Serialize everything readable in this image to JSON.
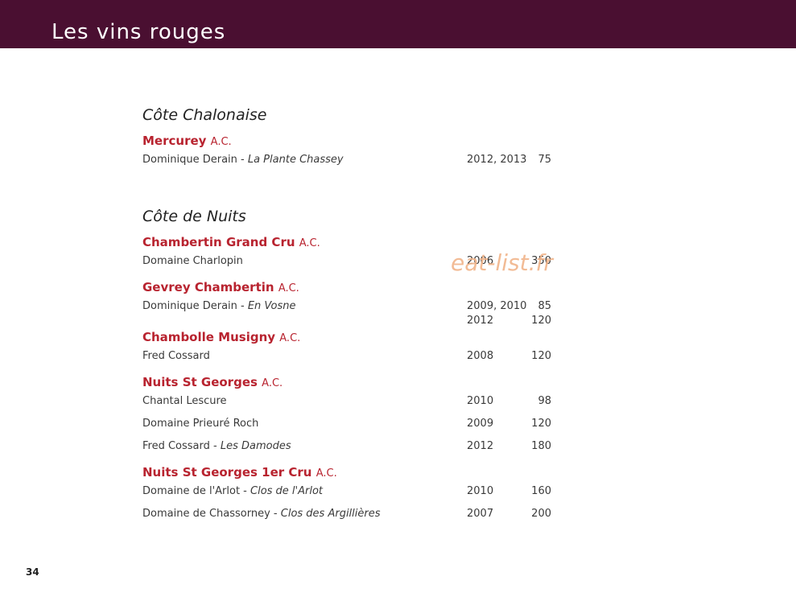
{
  "header": {
    "title": "Les vins rouges"
  },
  "sections": [
    {
      "title": "Côte Chalonaise",
      "appellations": [
        {
          "name": "Mercurey",
          "ac": "A.C.",
          "wines": [
            {
              "producer": "Dominique Derain - ",
              "cuvee": "La Plante Chassey",
              "vintage": "2012, 2013",
              "price": "75"
            }
          ]
        }
      ]
    },
    {
      "title": "Côte de Nuits",
      "appellations": [
        {
          "name": "Chambertin Grand Cru",
          "ac": "A.C.",
          "wines": [
            {
              "producer": "Domaine Charlopin",
              "cuvee": "",
              "vintage": "2006",
              "price": "350"
            }
          ]
        },
        {
          "name": "Gevrey Chambertin",
          "ac": "A.C.",
          "wines": [
            {
              "producer": "Dominique Derain - ",
              "cuvee": "En Vosne",
              "vintage": "2009, 2010",
              "price": "85"
            },
            {
              "producer": "",
              "cuvee": "",
              "vintage": "2012",
              "price": "120"
            }
          ]
        },
        {
          "name": "Chambolle Musigny",
          "ac": "A.C.",
          "wines": [
            {
              "producer": "Fred Cossard",
              "cuvee": "",
              "vintage": "2008",
              "price": "120"
            }
          ]
        },
        {
          "name": "Nuits St Georges",
          "ac": "A.C.",
          "wines": [
            {
              "producer": "Chantal Lescure",
              "cuvee": "",
              "vintage": "2010",
              "price": "98"
            },
            {
              "producer": "Domaine Prieuré Roch",
              "cuvee": "",
              "vintage": "2009",
              "price": "120"
            },
            {
              "producer": "Fred Cossard - ",
              "cuvee": "Les Damodes",
              "vintage": "2012",
              "price": "180"
            }
          ]
        },
        {
          "name": "Nuits St Georges 1er Cru",
          "ac": "A.C.",
          "wines": [
            {
              "producer": "Domaine de l'Arlot - ",
              "cuvee": "Clos de l'Arlot",
              "vintage": "2010",
              "price": "160"
            },
            {
              "producer": "Domaine de Chassorney - ",
              "cuvee": "Clos des Argillières",
              "vintage": "2007",
              "price": "200"
            }
          ]
        }
      ]
    }
  ],
  "watermark": "eat-list.fr",
  "page_number": "34"
}
